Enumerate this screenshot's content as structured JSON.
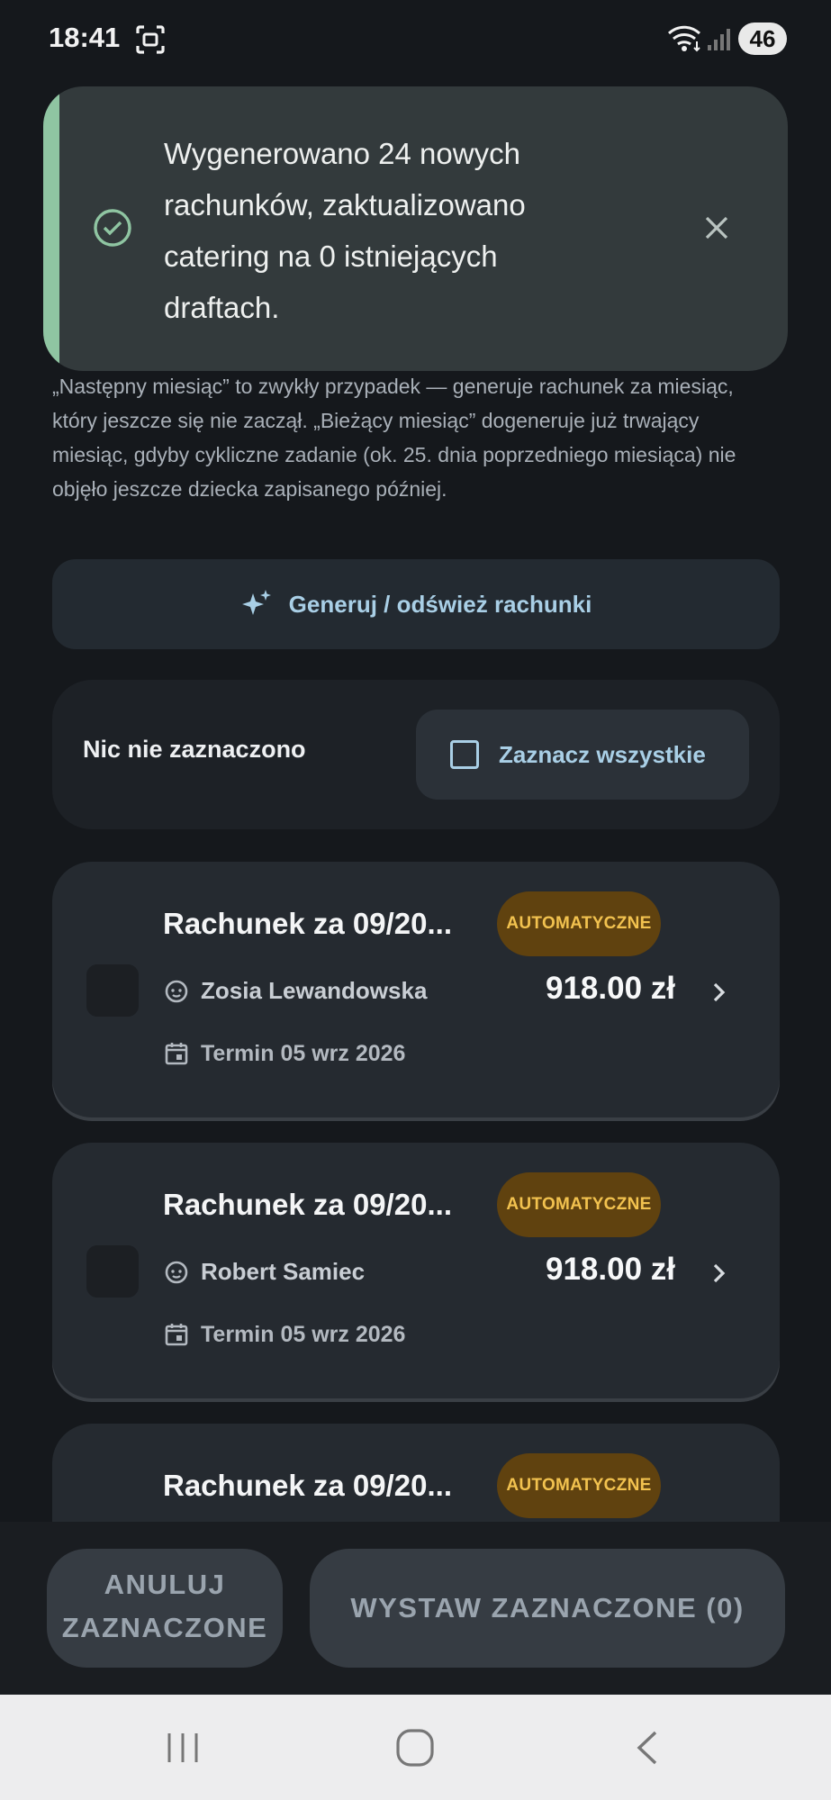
{
  "status_bar": {
    "time": "18:41",
    "battery": "46",
    "icons": [
      "screenshot-icon",
      "wifi-icon",
      "signal-icon"
    ]
  },
  "toast": {
    "message": "Wygenerowano 24 nowych rachunków, zaktualizowano catering na 0 istniejących draftach.",
    "accent_color": "#8fc5a2",
    "icons": [
      "check-circle-icon",
      "close-icon"
    ]
  },
  "description": "„Następny miesiąc” to zwykły przypadek — generuje rachunek za miesiąc, który jeszcze się nie zaczął. „Bieżący miesiąc” dogeneruje już trwający miesiąc, gdyby cykliczne zadanie (ok. 25. dnia poprzedniego miesiąca) nie objęło jeszcze dziecka zapisanego później.",
  "generate_button": {
    "label": "Generuj / odśwież rachunki",
    "icon": "sparkles-icon"
  },
  "selection": {
    "status": "Nic nie zaznaczono",
    "select_all_label": "Zaznacz wszystkie"
  },
  "invoices": [
    {
      "title": "Rachunek za 09/20...",
      "badge": "AUTOMATYCZNE",
      "child": "Zosia Lewandowska",
      "amount": "918.00 zł",
      "due": "Termin 05 wrz 2026"
    },
    {
      "title": "Rachunek za 09/20...",
      "badge": "AUTOMATYCZNE",
      "child": "Robert Samiec",
      "amount": "918.00 zł",
      "due": "Termin 05 wrz 2026"
    },
    {
      "title": "Rachunek za 09/20...",
      "badge": "AUTOMATYCZNE"
    }
  ],
  "actions": {
    "cancel_line1": "ANULUJ",
    "cancel_line2": "ZAZNACZONE",
    "issue_label": "WYSTAW ZAZNACZONE (0)"
  },
  "colors": {
    "background": "#15181c",
    "card": "#252a30",
    "accent_blue": "#a9cfe6",
    "badge_bg": "#60420f",
    "badge_text": "#f2c24f"
  }
}
